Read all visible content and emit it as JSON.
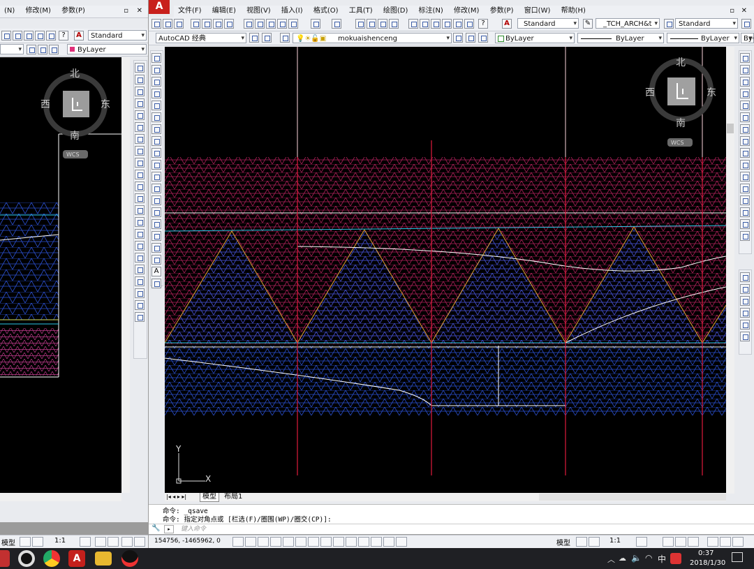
{
  "left_window": {
    "menu": [
      "(N)",
      "修改(M)",
      "参数(P)"
    ],
    "style_combo": "Standard",
    "layer_combo": "ByLayer",
    "compass": {
      "north": "北",
      "south": "南",
      "west": "西",
      "east": "东",
      "center": "上",
      "ucs": "WCS"
    }
  },
  "main_window": {
    "menu": [
      "文件(F)",
      "编辑(E)",
      "视图(V)",
      "插入(I)",
      "格式(O)",
      "工具(T)",
      "绘图(D)",
      "标注(N)",
      "修改(M)",
      "参数(P)",
      "窗口(W)",
      "帮助(H)"
    ],
    "text_style_combo": "Standard",
    "dim_style_combo": "_TCH_ARCH&t",
    "table_style_combo": "Standard",
    "workspace_combo": "AutoCAD 经典",
    "layer_combo": "mokuaishenceng",
    "color_combo": "ByLayer",
    "linetype_combo": "ByLayer",
    "lineweight_combo": "ByLayer",
    "plot_combo": "ByC",
    "compass": {
      "north": "北",
      "south": "南",
      "west": "西",
      "east": "东",
      "center": "上",
      "ucs": "WCS"
    },
    "ucs_axis": {
      "x": "X",
      "y": "Y"
    },
    "tabs": [
      "模型",
      "布局1"
    ]
  },
  "command": {
    "lines": [
      "命令: _qsave",
      "命令: 指定对角点或 [栏选(F)/圈围(WP)/圈交(CP)]:"
    ],
    "placeholder": "键入命令"
  },
  "status": {
    "coords": "154756, -1465962, 0",
    "left_label": "模型",
    "scale": "1:1",
    "right_label": "模型",
    "right_scale": "1:1"
  },
  "taskbar": {
    "time": "0:37",
    "date": "2018/1/30",
    "ime": "中"
  },
  "colors": {
    "canvas": "#000000",
    "magenta_hatch": "#b0205a",
    "blue_hatch": "#2a4fd0",
    "triangle_edge": "#e0a030",
    "red_axis": "#e01a3c",
    "white_line": "#ffffff",
    "cyan_line": "#2ac8e8"
  }
}
